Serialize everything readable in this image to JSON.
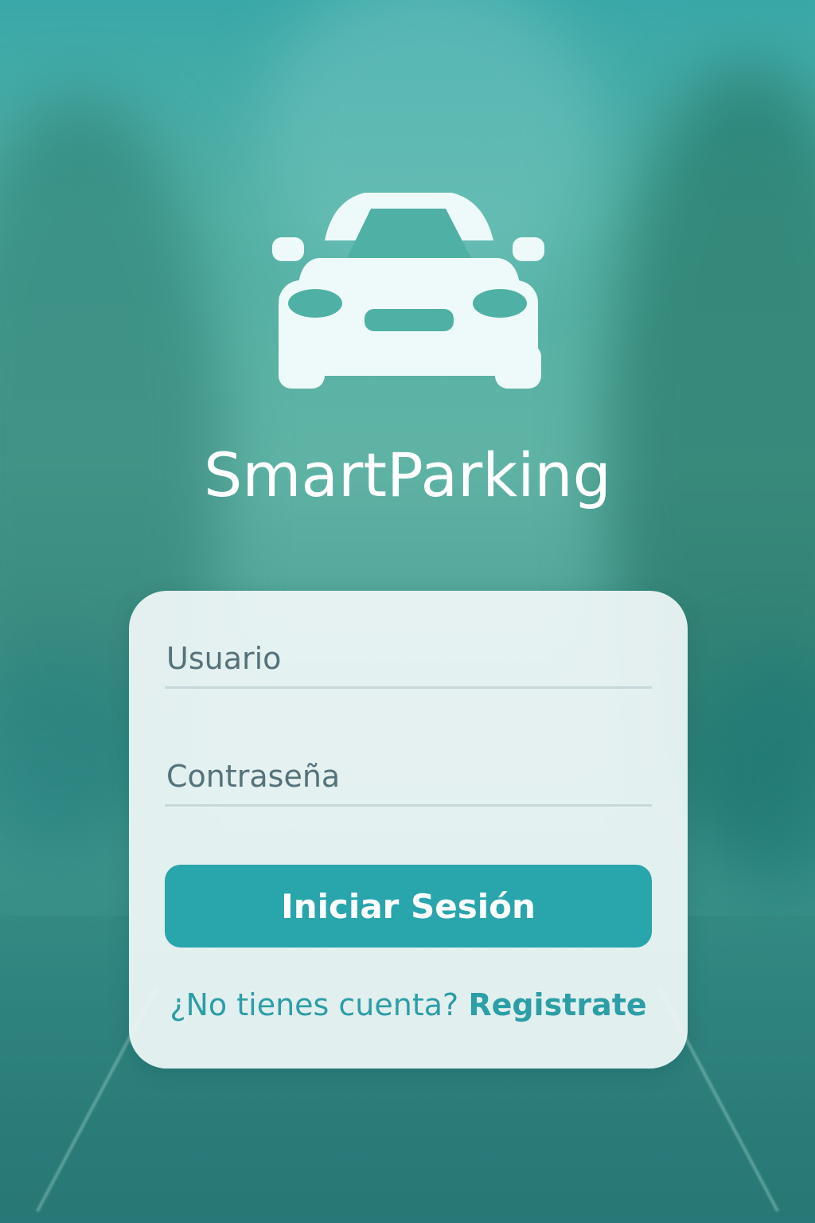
{
  "app": {
    "title": "SmartParking",
    "logo_icon": "car-icon"
  },
  "login_form": {
    "username_placeholder": "Usuario",
    "password_placeholder": "Contraseña",
    "submit_label": "Iniciar Sesión",
    "register_prompt": "¿No tienes cuenta?",
    "register_link": "Registrate"
  },
  "colors": {
    "accent": "#29a5ac",
    "background_tint": "#4aa99f",
    "card_background": "#eef6f6",
    "link_text": "#2c9ea6"
  }
}
